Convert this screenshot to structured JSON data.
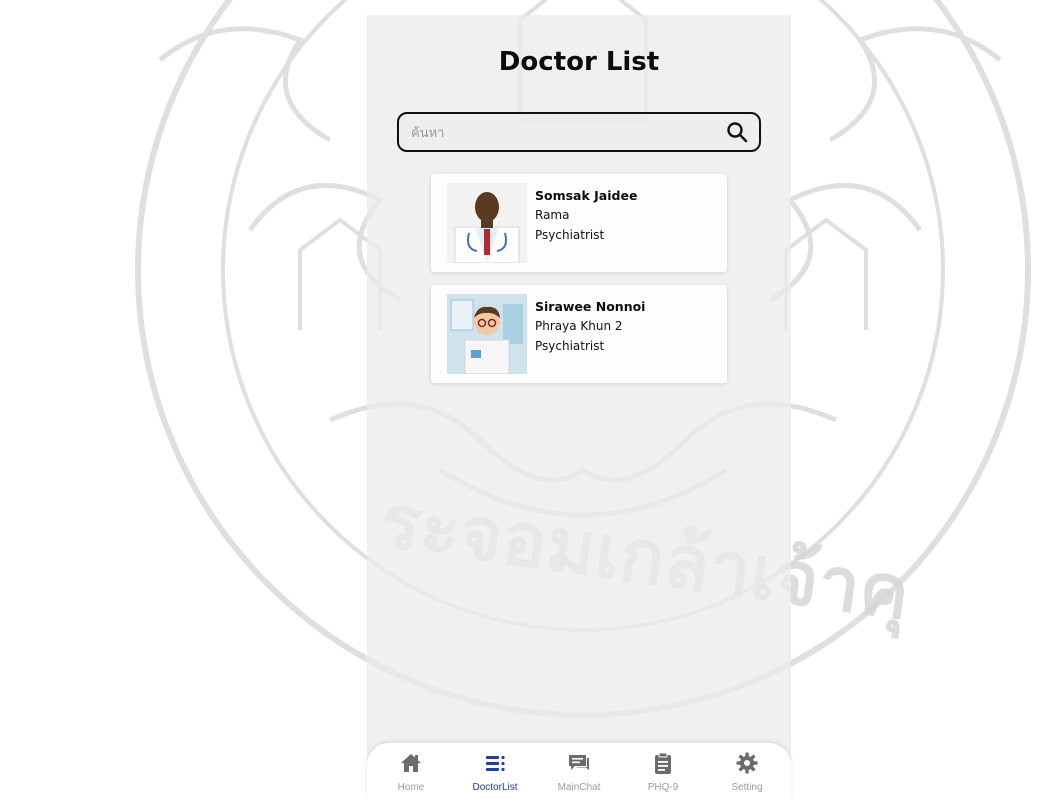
{
  "page": {
    "title": "Doctor List"
  },
  "search": {
    "placeholder": "ค้นหา",
    "value": ""
  },
  "doctors": [
    {
      "name": "Somsak Jaidee",
      "hospital": "Rama",
      "specialty": "Psychiatrist"
    },
    {
      "name": "Sirawee Nonnoi",
      "hospital": "Phraya Khun 2",
      "specialty": "Psychiatrist"
    }
  ],
  "tabs": [
    {
      "label": "Home",
      "icon": "home-icon",
      "active": false
    },
    {
      "label": "DoctorList",
      "icon": "list-icon",
      "active": true
    },
    {
      "label": "MainChat",
      "icon": "chat-icon",
      "active": false
    },
    {
      "label": "PHQ-9",
      "icon": "clipboard-icon",
      "active": false
    },
    {
      "label": "Setting",
      "icon": "gear-icon",
      "active": false
    }
  ],
  "colors": {
    "accent": "#1f3f9f",
    "inactive_tab": "#6b6b6b",
    "watermark": "#d9d9d9"
  }
}
